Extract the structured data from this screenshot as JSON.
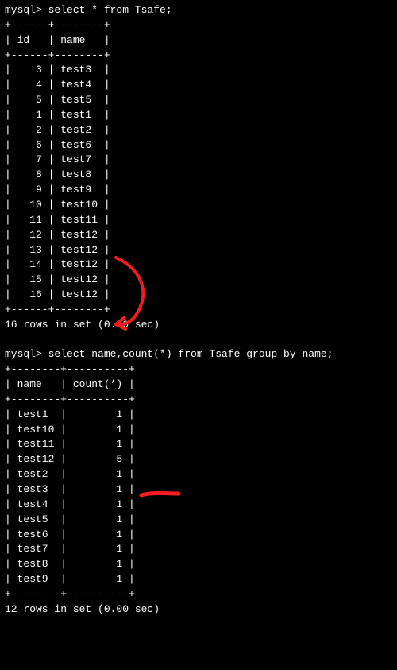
{
  "query1": {
    "prompt": "mysql> ",
    "sql": "select * from Tsafe;",
    "sep_top": "+------+--------+",
    "header": "| id   | name   |",
    "sep_mid": "+------+--------+",
    "rows": [
      "|    3 | test3  |",
      "|    4 | test4  |",
      "|    5 | test5  |",
      "|    1 | test1  |",
      "|    2 | test2  |",
      "|    6 | test6  |",
      "|    7 | test7  |",
      "|    8 | test8  |",
      "|    9 | test9  |",
      "|   10 | test10 |",
      "|   11 | test11 |",
      "|   12 | test12 |",
      "|   13 | test12 |",
      "|   14 | test12 |",
      "|   15 | test12 |",
      "|   16 | test12 |"
    ],
    "sep_bot": "+------+--------+",
    "summary": "16 rows in set (0.00 sec)"
  },
  "blank1": " ",
  "query2": {
    "prompt": "mysql> ",
    "sql": "select name,count(*) from Tsafe group by name;",
    "sep_top": "+--------+----------+",
    "header": "| name   | count(*) |",
    "sep_mid": "+--------+----------+",
    "rows": [
      "| test1  |        1 |",
      "| test10 |        1 |",
      "| test11 |        1 |",
      "| test12 |        5 |",
      "| test2  |        1 |",
      "| test3  |        1 |",
      "| test4  |        1 |",
      "| test5  |        1 |",
      "| test6  |        1 |",
      "| test7  |        1 |",
      "| test8  |        1 |",
      "| test9  |        1 |"
    ],
    "sep_bot": "+--------+----------+",
    "summary": "12 rows in set (0.00 sec)"
  },
  "chart_data": {
    "type": "table",
    "tables": [
      {
        "title": "select * from Tsafe;",
        "columns": [
          "id",
          "name"
        ],
        "rows": [
          [
            3,
            "test3"
          ],
          [
            4,
            "test4"
          ],
          [
            5,
            "test5"
          ],
          [
            1,
            "test1"
          ],
          [
            2,
            "test2"
          ],
          [
            6,
            "test6"
          ],
          [
            7,
            "test7"
          ],
          [
            8,
            "test8"
          ],
          [
            9,
            "test9"
          ],
          [
            10,
            "test10"
          ],
          [
            11,
            "test11"
          ],
          [
            12,
            "test12"
          ],
          [
            13,
            "test12"
          ],
          [
            14,
            "test12"
          ],
          [
            15,
            "test12"
          ],
          [
            16,
            "test12"
          ]
        ],
        "summary_rows": 16,
        "summary_time_sec": 0.0
      },
      {
        "title": "select name,count(*) from Tsafe group by name;",
        "columns": [
          "name",
          "count(*)"
        ],
        "rows": [
          [
            "test1",
            1
          ],
          [
            "test10",
            1
          ],
          [
            "test11",
            1
          ],
          [
            "test12",
            5
          ],
          [
            "test2",
            1
          ],
          [
            "test3",
            1
          ],
          [
            "test4",
            1
          ],
          [
            "test5",
            1
          ],
          [
            "test6",
            1
          ],
          [
            "test7",
            1
          ],
          [
            "test8",
            1
          ],
          [
            "test9",
            1
          ]
        ],
        "summary_rows": 12,
        "summary_time_sec": 0.0
      }
    ]
  },
  "annotation": {
    "color": "#f41c1c"
  }
}
